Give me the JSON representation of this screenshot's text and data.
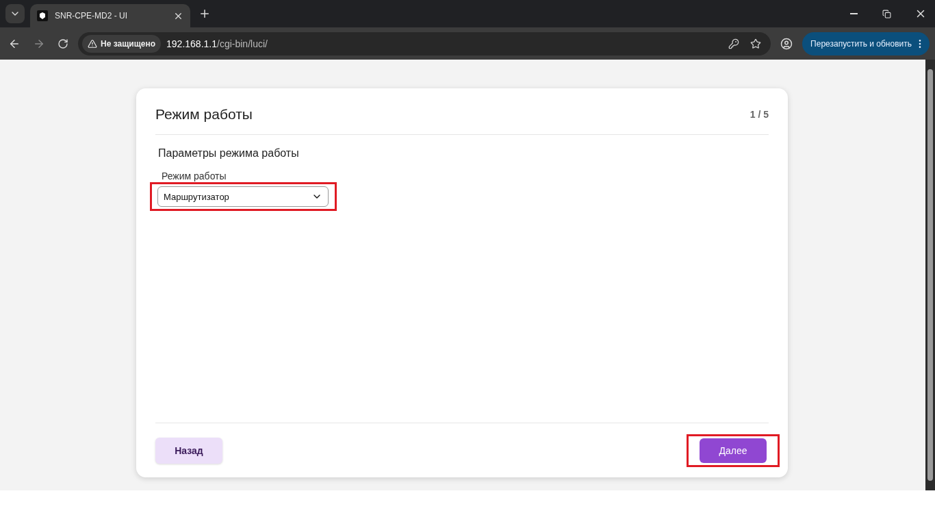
{
  "browser": {
    "tab_title": "SNR-CPE-MD2 - UI",
    "security_label": "Не защищено",
    "url_host": "192.168.1.1",
    "url_path": "/cgi-bin/luci/",
    "update_button": "Перезапустить и обновить"
  },
  "wizard": {
    "title": "Режим работы",
    "step": "1 / 5",
    "section_title": "Параметры режима работы",
    "field_label": "Режим работы",
    "select_value": "Маршрутизатор",
    "select_highlighted": true,
    "back_button": "Назад",
    "next_button": "Далее",
    "next_highlighted": true
  }
}
